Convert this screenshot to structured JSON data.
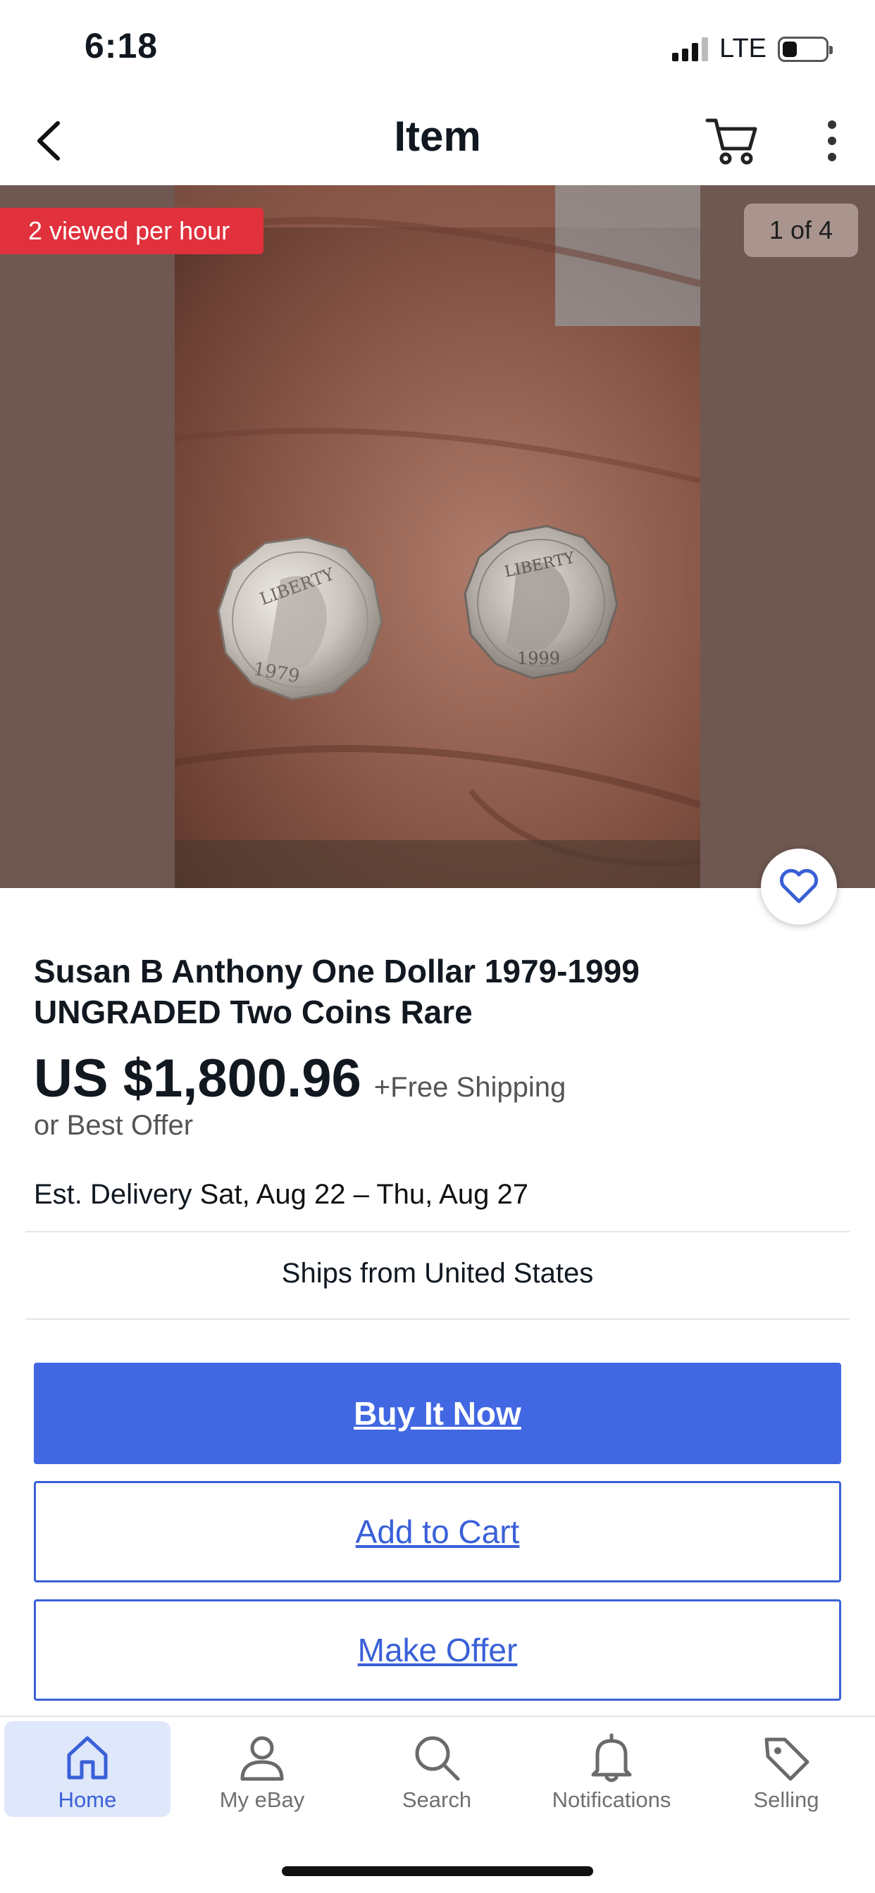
{
  "status_bar": {
    "time": "6:18",
    "carrier": "LTE",
    "battery_level": 0.35
  },
  "nav": {
    "title": "Item",
    "back_icon": "chevron-left-icon",
    "cart_icon": "cart-icon",
    "more_icon": "more-vertical-icon"
  },
  "gallery": {
    "views_badge": "2 viewed per hour",
    "image_counter": "1 of 4",
    "coin_years": [
      "1979",
      "1999"
    ],
    "coin_legend": "LIBERTY"
  },
  "item": {
    "title": "Susan B Anthony One Dollar 1979-1999 UNGRADED Two Coins Rare",
    "price": "US $1,800.96",
    "shipping": "+Free Shipping",
    "best_offer": "or Best Offer",
    "delivery_label": "Est. Delivery",
    "delivery_dates": "Sat, Aug 22 – Thu, Aug 27",
    "ships_from": "Ships from United States"
  },
  "actions": {
    "buy_now": "Buy It Now",
    "add_to_cart": "Add to Cart",
    "make_offer": "Make Offer"
  },
  "tabs": [
    {
      "label": "Home",
      "icon": "home-icon",
      "active": true
    },
    {
      "label": "My eBay",
      "icon": "person-icon",
      "active": false
    },
    {
      "label": "Search",
      "icon": "search-icon",
      "active": false
    },
    {
      "label": "Notifications",
      "icon": "bell-icon",
      "active": false
    },
    {
      "label": "Selling",
      "icon": "tag-icon",
      "active": false
    }
  ],
  "colors": {
    "primary": "#4267e2",
    "badge_red": "#e0313c",
    "active_tab_bg": "#dfe7fb"
  }
}
